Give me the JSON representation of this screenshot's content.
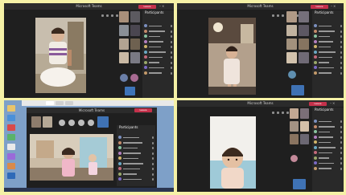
{
  "windows": [
    {
      "id": "top-left",
      "title": "Microsoft Teams",
      "leave_label": "Leave",
      "panel_title": "Participants",
      "invite_label": "Add people",
      "participants": 10
    },
    {
      "id": "top-right",
      "title": "Microsoft Teams",
      "leave_label": "Leave",
      "panel_title": "Participants",
      "invite_label": "Add people",
      "participants": 10
    },
    {
      "id": "bottom-left",
      "title": "Microsoft Teams",
      "leave_label": "Leave",
      "panel_title": "Participants",
      "invite_label": "Add people",
      "participants": 9
    },
    {
      "id": "bottom-right",
      "title": "Microsoft Teams",
      "leave_label": "Leave",
      "panel_title": "Participants",
      "invite_label": "Add people",
      "participants": 10
    }
  ],
  "icons": [
    "camera-icon",
    "mic-icon",
    "share-icon",
    "hand-icon",
    "more-icon",
    "people-icon",
    "chat-icon",
    "close-icon",
    "minimize-icon",
    "maximize-icon"
  ],
  "colors": {
    "leave": "#c4314b",
    "teams_bg": "#1f1f1f",
    "panel_bg": "#292929",
    "page_bg": "#f5f1a6",
    "desktop": "#7ea0c8"
  }
}
